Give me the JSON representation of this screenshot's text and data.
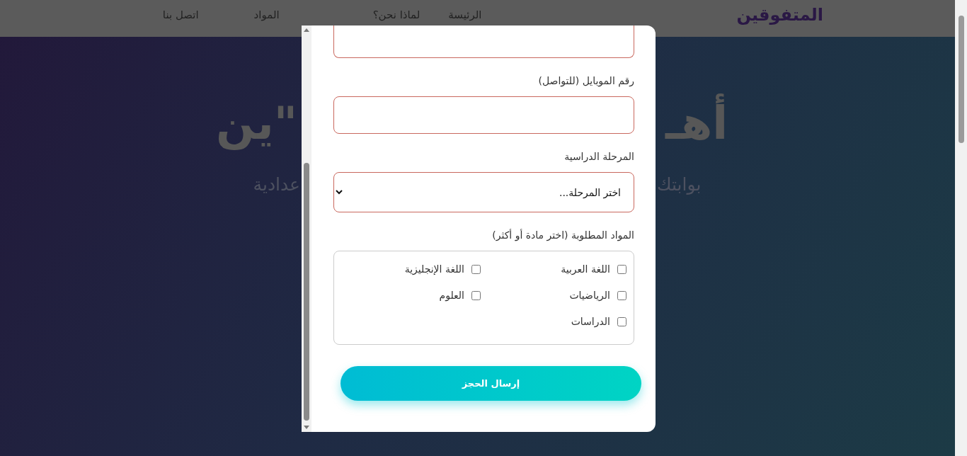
{
  "header": {
    "logo": "المتفوقين",
    "nav": [
      {
        "label": "الرئيسة"
      },
      {
        "label": "لماذا نحن؟"
      },
      {
        "label": "المواد"
      },
      {
        "label": "اتصل بنا"
      }
    ]
  },
  "hero": {
    "title_right": "أهـ",
    "title_left": "ين\"",
    "subtitle_right": "بوابتك",
    "subtitle_left": "عدادية"
  },
  "modal": {
    "fields": [
      {
        "kind": "input",
        "label": "رقم الموبايل (للتواصل)"
      },
      {
        "kind": "select",
        "label": "المرحلة الدراسية",
        "value": "اختر المرحلة..."
      }
    ],
    "subjects": {
      "label": "المواد المطلوبة (اختر مادة أو أكثر)",
      "items": [
        {
          "label": "اللغة العربية",
          "checked": false
        },
        {
          "label": "اللغة الإنجليزية",
          "checked": false
        },
        {
          "label": "الرياضيات",
          "checked": false
        },
        {
          "label": "العلوم",
          "checked": false
        },
        {
          "label": "الدراسات",
          "checked": false
        }
      ]
    },
    "submit": "إرسال الحجز"
  }
}
